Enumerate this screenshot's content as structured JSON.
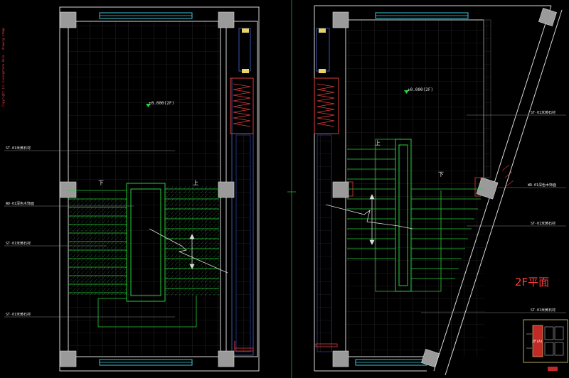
{
  "watermark": "Copyright (c) Livingstone Asia - drawing stamp",
  "left_plan": {
    "level_mark": "±0.000(2F)",
    "stair_down": "下",
    "stair_up": "上",
    "labels": [
      "ST-01米黄石材",
      "WD-01深色木饰面",
      "ST-01米黄石材",
      "ST-01米黄石材"
    ]
  },
  "right_plan": {
    "level_mark": "±0.000(2F)",
    "stair_up": "上",
    "stair_down": "下",
    "labels": [
      "ST-01米黄石材",
      "WD-01深色木饰面",
      "ST-01米黄石材",
      "ST-01米黄石材"
    ]
  },
  "plan_title": "2F平面",
  "key_plan": {
    "text": "2F(A)"
  },
  "colors": {
    "background": "#000000",
    "wall": "#d9d9d9",
    "grid": "#3c3c3c",
    "stair": "#26d13a",
    "window": "#3fc9d6",
    "door": "#e23b3b",
    "title": "#ff3b3b"
  }
}
